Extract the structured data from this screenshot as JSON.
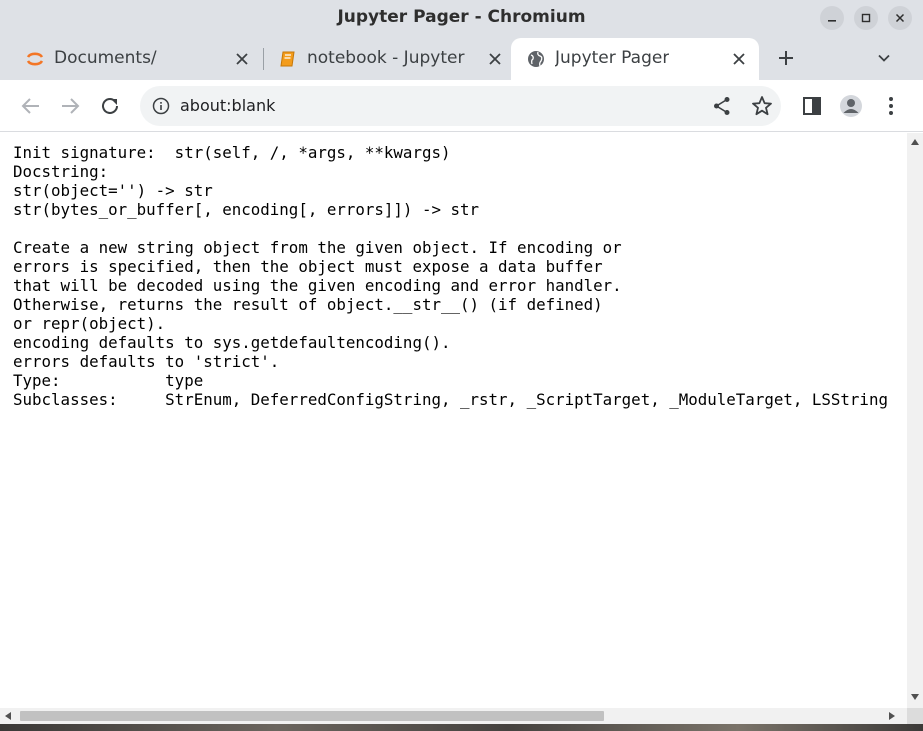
{
  "window": {
    "title": "Jupyter Pager - Chromium"
  },
  "tabs": [
    {
      "label": "Documents/",
      "icon": "jupyter-logo-icon",
      "active": false
    },
    {
      "label": "notebook - Jupyter N",
      "icon": "notebook-icon",
      "active": false
    },
    {
      "label": "Jupyter Pager",
      "icon": "globe-icon",
      "active": true
    }
  ],
  "toolbar": {
    "url": "about:blank"
  },
  "pager": {
    "lines": [
      "Init signature:  str(self, /, *args, **kwargs)",
      "Docstring:",
      "str(object='') -> str",
      "str(bytes_or_buffer[, encoding[, errors]]) -> str",
      "",
      "Create a new string object from the given object. If encoding or",
      "errors is specified, then the object must expose a data buffer",
      "that will be decoded using the given encoding and error handler.",
      "Otherwise, returns the result of object.__str__() (if defined)",
      "or repr(object).",
      "encoding defaults to sys.getdefaultencoding().",
      "errors defaults to 'strict'.",
      "Type:           type",
      "Subclasses:     StrEnum, DeferredConfigString, _rstr, _ScriptTarget, _ModuleTarget, LSString"
    ]
  },
  "colors": {
    "accent": "#1a73e8",
    "jupyter_orange": "#f37626",
    "chrome_frame": "#dee1e6"
  }
}
